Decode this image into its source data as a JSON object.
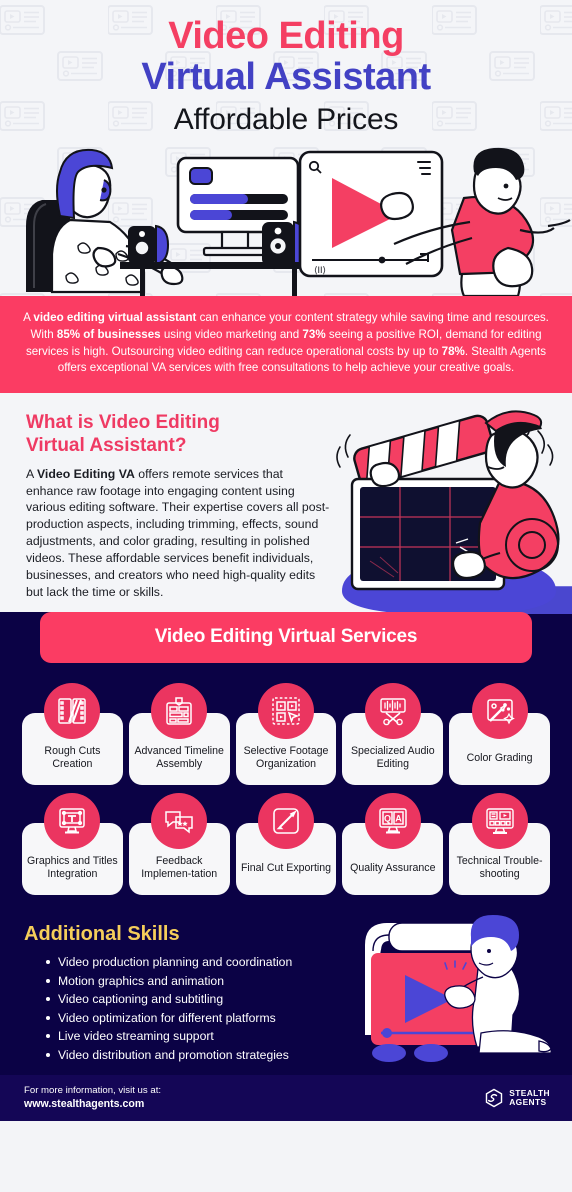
{
  "header": {
    "title_line1": "Video Editing",
    "title_line2": "Virtual Assistant",
    "title_line3": "Affordable Prices",
    "colors": {
      "line1": "#f43f63",
      "line2": "#4241c4",
      "line3": "#14161c",
      "background": "#f4f5f8"
    }
  },
  "intro": {
    "html": "A <b>video editing virtual assistant</b> can enhance your content strategy while saving time and resources. With <b>85% of businesses</b> using video marketing and <b>73%</b> seeing a positive ROI, demand for editing services is high. Outsourcing video editing can reduce operational costs by up to <b>78%</b>. Stealth Agents offers exceptional VA services with free consultations to help achieve your creative goals.",
    "stats": [
      "85%",
      "73%",
      "78%"
    ],
    "background": "#fb3c63"
  },
  "whatis": {
    "heading_line1": "What is Video Editing",
    "heading_line2": "Virtual Assistant?",
    "heading_color": "#ef3a63",
    "body_html": "A <b>Video Editing VA</b> offers remote services that enhance raw footage into engaging content using various editing software. Their expertise covers all post-production aspects, including trimming, effects, sound adjustments, and color grading, resulting in polished videos. These affordable services benefit individuals, businesses, and creators who need high-quality edits but lack the time or skills."
  },
  "services": {
    "banner_label": "Video Editing Virtual Services",
    "banner_color": "#fb3c63",
    "section_background": "#0b0245",
    "icon_circle_color": "#eb3560",
    "row1": [
      {
        "label": "Rough Cuts Creation",
        "icon": "film-strips-icon"
      },
      {
        "label": "Advanced Timeline Assembly",
        "icon": "timeline-layers-icon"
      },
      {
        "label": "Selective Footage Organization",
        "icon": "clip-grid-icon"
      },
      {
        "label": "Specialized Audio Editing",
        "icon": "audio-waveform-scissors-icon"
      },
      {
        "label": "Color Grading",
        "icon": "image-wand-icon"
      }
    ],
    "row2": [
      {
        "label": "Graphics and Titles Integration",
        "icon": "monitor-text-icon"
      },
      {
        "label": "Feedback Implemen-tation",
        "icon": "chat-bubbles-icon"
      },
      {
        "label": "Final Cut Exporting",
        "icon": "pencil-frame-icon"
      },
      {
        "label": "Quality Assurance",
        "icon": "qa-monitor-icon"
      },
      {
        "label": "Technical Trouble-shooting",
        "icon": "editing-desk-monitor-icon"
      }
    ]
  },
  "skills": {
    "heading": "Additional Skills",
    "heading_color": "#f5ce5a",
    "items": [
      "Video production planning and coordination",
      "Motion graphics and animation",
      "Video captioning and subtitling",
      "Video optimization for different platforms",
      "Live video streaming support",
      "Video distribution and promotion strategies"
    ]
  },
  "footer": {
    "prompt": "For more information, visit us at:",
    "url": "www.stealthagents.com",
    "brand_line1": "STEALTH",
    "brand_line2": "AGENTS"
  }
}
